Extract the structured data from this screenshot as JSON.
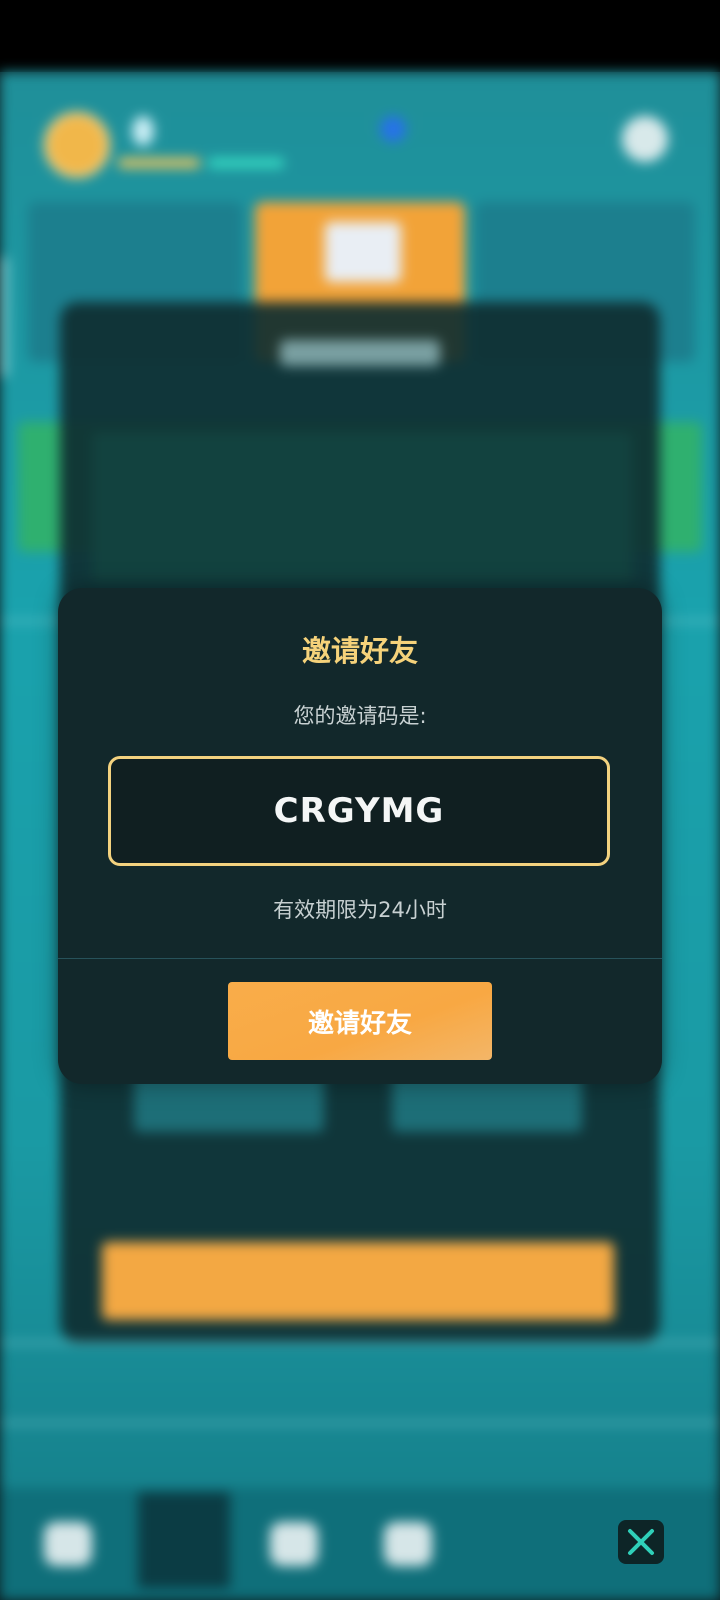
{
  "dialog": {
    "title": "邀请好友",
    "subtitle": "您的邀请码是:",
    "code": "CRGYMG",
    "expiry": "有效期限为24小时",
    "button_label": "邀请好友"
  },
  "colors": {
    "title": "#f5d27a",
    "code_border": "#f3d27f",
    "button": "#f8a843",
    "dialog_bg": "#12282b",
    "close_icon": "#2fd0b9"
  },
  "icons": {
    "close": "close-icon"
  }
}
